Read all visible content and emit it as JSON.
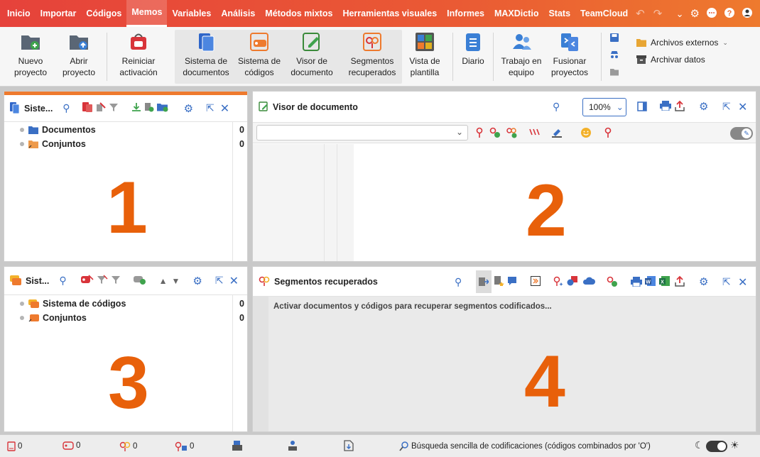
{
  "menu": {
    "tabs": [
      "Inicio",
      "Importar",
      "Códigos",
      "Memos",
      "Variables",
      "Análisis",
      "Métodos mixtos",
      "Herramientas visuales",
      "Informes",
      "MAXDictio",
      "Stats",
      "TeamCloud"
    ],
    "active_tab": "Memos"
  },
  "ribbon": {
    "new_project": "Nuevo proyecto",
    "open_project": "Abrir proyecto",
    "reset_activation": "Reiniciar activación",
    "document_system": "Sistema de documentos",
    "code_system": "Sistema de códigos",
    "document_browser": "Visor de documento",
    "retrieved_segments": "Segmentos recuperados",
    "template_view": "Vista de plantilla",
    "logbook": "Diario",
    "teamwork": "Trabajo en equipo",
    "merge_projects": "Fusionar proyectos",
    "external_files": "Archivos externos",
    "archive_data": "Archivar datos"
  },
  "panes": {
    "doc_system": {
      "title": "Siste...",
      "number": "1",
      "rows": [
        {
          "label": "Documentos",
          "count": "0"
        },
        {
          "label": "Conjuntos",
          "count": "0"
        }
      ]
    },
    "doc_browser": {
      "title": "Visor de documento",
      "zoom": "100%",
      "number": "2"
    },
    "code_system": {
      "title": "Sist...",
      "number": "3",
      "rows": [
        {
          "label": "Sistema de códigos",
          "count": "0"
        },
        {
          "label": "Conjuntos",
          "count": "0"
        }
      ]
    },
    "retrieved": {
      "title": "Segmentos recuperados",
      "message": "Activar documentos y códigos para recuperar segmentos codificados...",
      "number": "4"
    }
  },
  "status": {
    "docs": "0",
    "codes": "0",
    "segments": "0",
    "memos": "0",
    "search_mode": "Búsqueda sencilla de codificaciones (códigos combinados por 'O')"
  },
  "colors": {
    "accent": "#e8600a",
    "menu_start": "#e6423b",
    "menu_end": "#ee7a2e",
    "blue": "#3a6fc4"
  }
}
